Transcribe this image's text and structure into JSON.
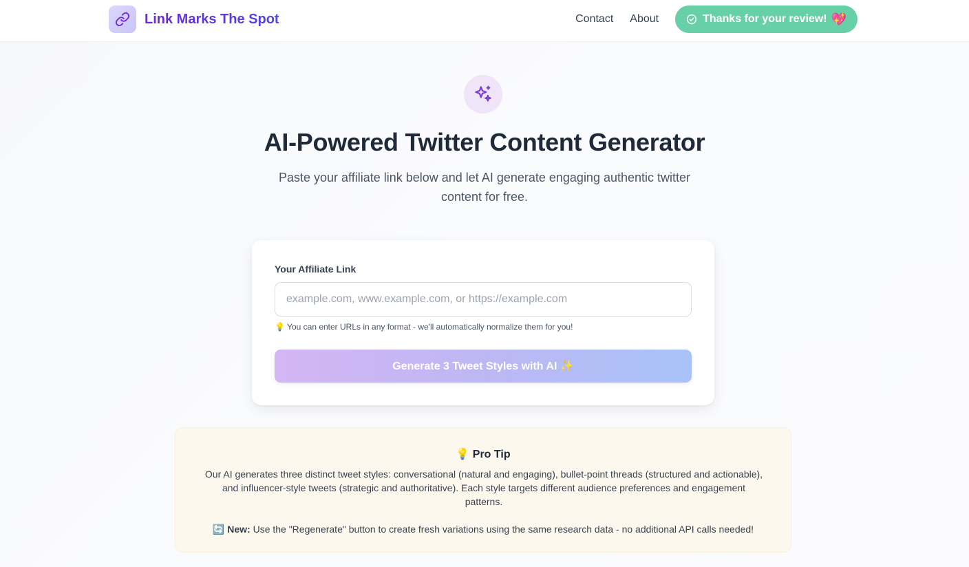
{
  "brand": {
    "name": "Link Marks The Spot",
    "logo_icon": "link-icon"
  },
  "nav": {
    "links": [
      "Contact",
      "About"
    ],
    "review_button": {
      "label": "Thanks for your review!",
      "emoji": "💖",
      "icon": "check-circle-icon"
    }
  },
  "hero": {
    "icon": "sparkles-icon",
    "title": "AI-Powered Twitter Content Generator",
    "subtitle": "Paste your affiliate link below and let AI generate engaging authentic twitter content for free."
  },
  "form": {
    "label": "Your Affiliate Link",
    "input_value": "",
    "input_placeholder": "example.com, www.example.com, or https://example.com",
    "hint": "💡 You can enter URLs in any format - we'll automatically normalize them for you!",
    "submit_label": "Generate 3 Tweet Styles with AI ✨"
  },
  "pro_tip": {
    "title": "💡 Pro Tip",
    "body": "Our AI generates three distinct tweet styles: conversational (natural and engaging), bullet-point threads (structured and actionable), and influencer-style tweets (strategic and authoritative). Each style targets different audience preferences and engagement patterns.",
    "new_prefix": "🔄 New:",
    "new_text": " Use the \"Regenerate\" button to create fresh variations using the same research data - no additional API calls needed!"
  },
  "colors": {
    "brand_purple": "#6d28d9",
    "review_green": "#68d0a8",
    "button_gradient_start": "#d4b6f3",
    "button_gradient_end": "#a8c3f8",
    "tip_background": "#fdf8ee"
  }
}
